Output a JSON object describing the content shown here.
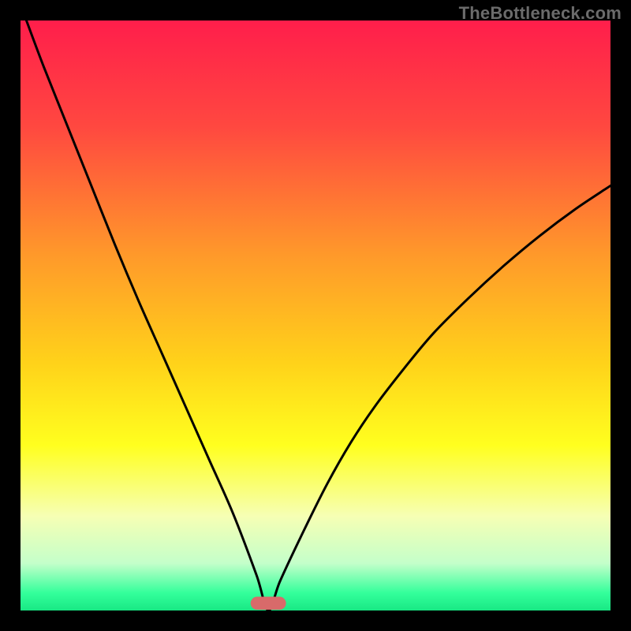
{
  "watermark": "TheBottleneck.com",
  "colors": {
    "frame": "#000000",
    "curve": "#000000",
    "marker_fill": "#d86a6a",
    "gradient_stops": [
      {
        "offset": 0,
        "color": "#ff1e4b"
      },
      {
        "offset": 18,
        "color": "#ff4840"
      },
      {
        "offset": 40,
        "color": "#ff9a2a"
      },
      {
        "offset": 58,
        "color": "#ffd21a"
      },
      {
        "offset": 72,
        "color": "#ffff1f"
      },
      {
        "offset": 84,
        "color": "#f6ffb4"
      },
      {
        "offset": 92,
        "color": "#c4ffca"
      },
      {
        "offset": 97,
        "color": "#34ff9b"
      },
      {
        "offset": 100,
        "color": "#18e884"
      }
    ]
  },
  "chart_data": {
    "type": "line",
    "title": "",
    "xlabel": "",
    "ylabel": "",
    "xlim": [
      0,
      100
    ],
    "ylim": [
      0,
      100
    ],
    "optimum_x": 42,
    "marker": {
      "x_center": 42,
      "width": 6,
      "height": 2.2
    },
    "series": [
      {
        "name": "left-branch",
        "x": [
          1,
          4,
          8,
          12,
          16,
          20,
          24,
          28,
          32,
          36,
          40,
          42
        ],
        "y": [
          100,
          92,
          82,
          72,
          62,
          52.5,
          43.5,
          34.5,
          25.5,
          16.5,
          6,
          0
        ]
      },
      {
        "name": "right-branch",
        "x": [
          42,
          44,
          48,
          52,
          56,
          60,
          65,
          70,
          76,
          82,
          88,
          94,
          100
        ],
        "y": [
          0,
          5,
          13.5,
          21.5,
          28.5,
          34.5,
          41,
          47,
          53,
          58.5,
          63.5,
          68,
          72
        ]
      }
    ]
  }
}
